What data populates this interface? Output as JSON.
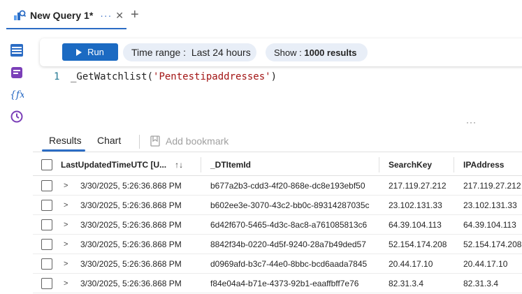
{
  "tab": {
    "title": "New Query 1*",
    "more": "···",
    "close": "✕",
    "add": "+"
  },
  "toolbar": {
    "run_label": "Run",
    "time_range_label": "Time range :",
    "time_range_value": "Last 24 hours",
    "show_label": "Show :",
    "show_value": "1000 results"
  },
  "editor": {
    "line_number": "1",
    "code_fn": "_GetWatchlist(",
    "code_str": "'Pentestipaddresses'",
    "code_end": ")",
    "splitter": "···"
  },
  "results": {
    "tabs": [
      "Results",
      "Chart"
    ],
    "bookmark_label": "Add bookmark",
    "columns": [
      "LastUpdatedTimeUTC [U...",
      "_DTItemId",
      "SearchKey",
      "IPAddress"
    ],
    "sort_icon": "↑↓",
    "rows": [
      {
        "time": "3/30/2025, 5:26:36.868 PM",
        "id": "b677a2b3-cdd3-4f20-868e-dc8e193ebf50",
        "key": "217.119.27.212",
        "ip": "217.119.27.212"
      },
      {
        "time": "3/30/2025, 5:26:36.868 PM",
        "id": "b602ee3e-3070-43c2-bb0c-89314287035c",
        "key": "23.102.131.33",
        "ip": "23.102.131.33"
      },
      {
        "time": "3/30/2025, 5:26:36.868 PM",
        "id": "6d42f670-5465-4d3c-8ac8-a761085813c6",
        "key": "64.39.104.113",
        "ip": "64.39.104.113"
      },
      {
        "time": "3/30/2025, 5:26:36.868 PM",
        "id": "8842f34b-0220-4d5f-9240-28a7b49ded57",
        "key": "52.154.174.208",
        "ip": "52.154.174.208"
      },
      {
        "time": "3/30/2025, 5:26:36.868 PM",
        "id": "d0969afd-b3c7-44e0-8bbc-bcd6aada7845",
        "key": "20.44.17.10",
        "ip": "20.44.17.10"
      },
      {
        "time": "3/30/2025, 5:26:36.868 PM",
        "id": "f84e04a4-b71e-4373-92b1-eaaffbff7e76",
        "key": "82.31.3.4",
        "ip": "82.31.3.4"
      }
    ]
  },
  "rail": {
    "icons": [
      "tables-icon",
      "queries-icon",
      "functions-icon",
      "history-icon"
    ]
  },
  "colors": {
    "accent": "#1b6ac2",
    "pill_bg": "#e8eef7",
    "string": "#a31515"
  }
}
